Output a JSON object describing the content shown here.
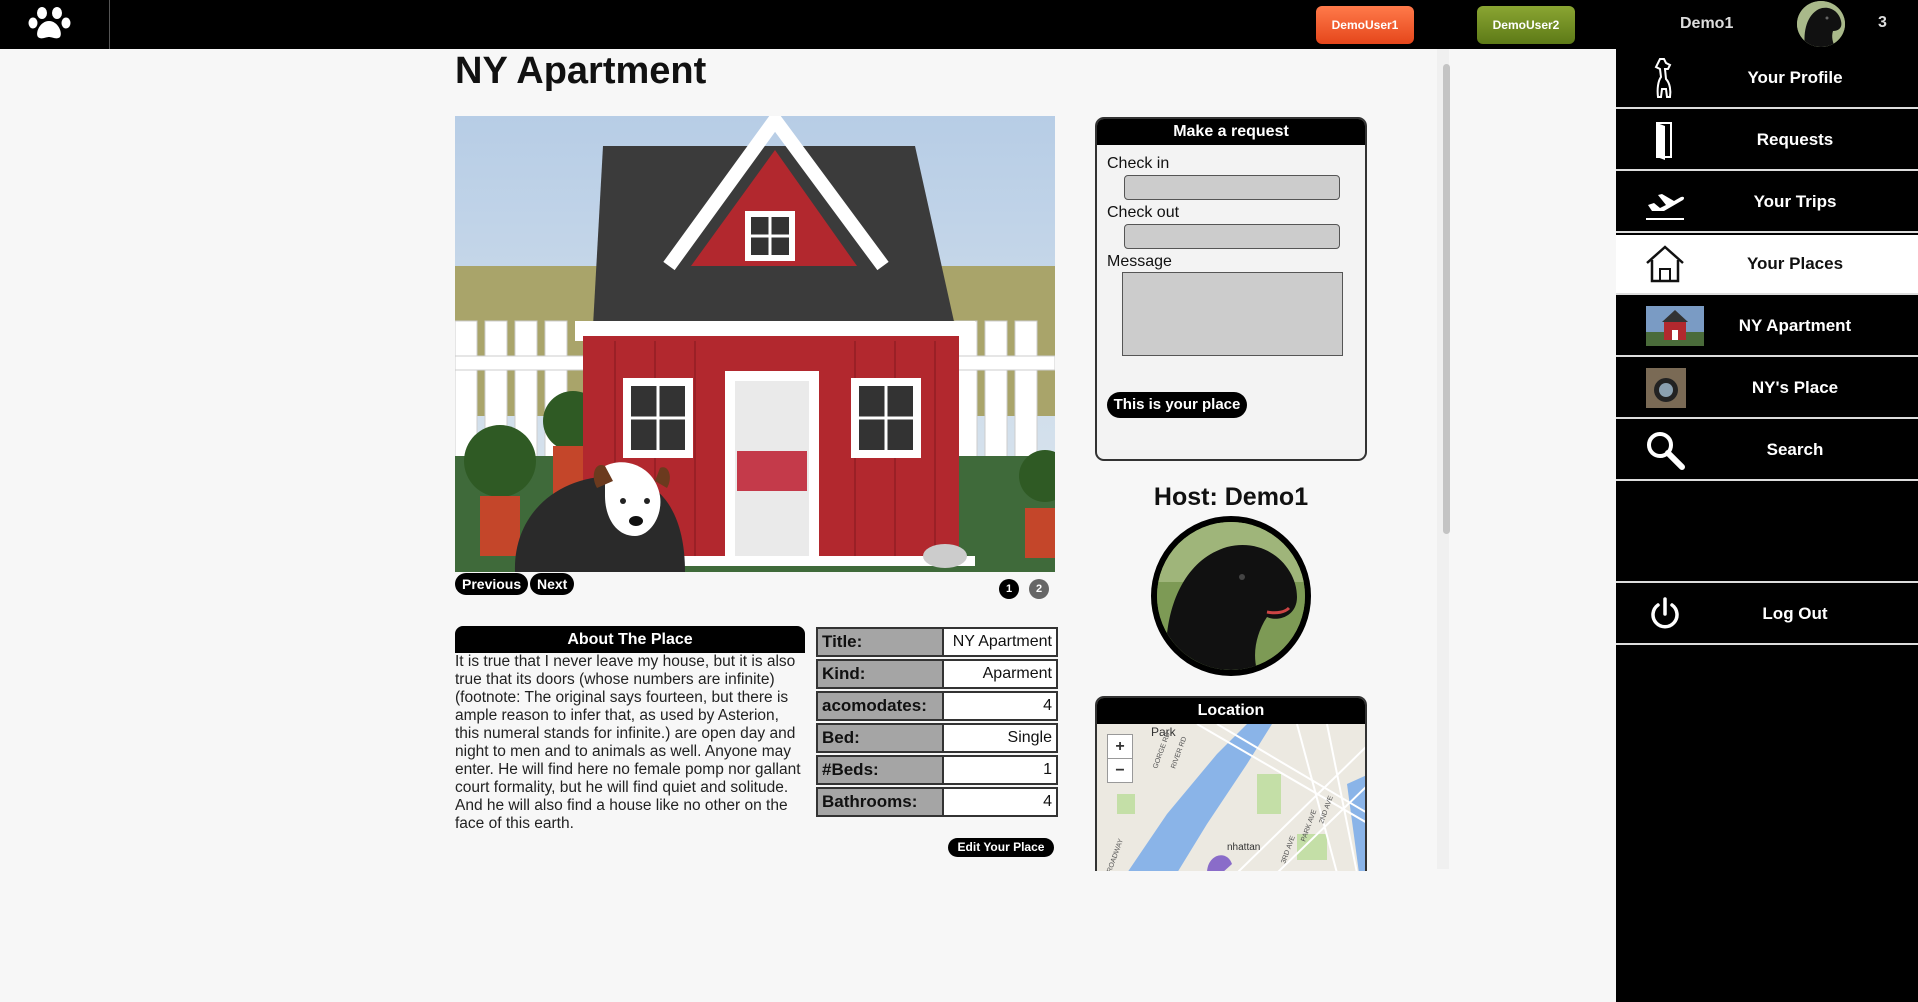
{
  "topbar": {
    "user_buttons": [
      "DemoUser1",
      "DemoUser2"
    ]
  },
  "sidebar": {
    "user_name": "Demo1",
    "notification_count": "3",
    "items": [
      {
        "label": "Your Profile",
        "icon": "dog-icon"
      },
      {
        "label": "Requests",
        "icon": "door-icon"
      },
      {
        "label": "Your Trips",
        "icon": "airplane-icon"
      },
      {
        "label": "Your Places",
        "icon": "house-icon",
        "active": true
      },
      {
        "label": "NY Apartment",
        "icon": "place-thumbnail"
      },
      {
        "label": "NY's Place",
        "icon": "place-thumbnail"
      },
      {
        "label": "Search",
        "icon": "search-icon"
      },
      {
        "label": "Log Out",
        "icon": "power-icon"
      }
    ]
  },
  "page": {
    "title": "NY Apartment"
  },
  "gallery": {
    "previous_label": "Previous",
    "next_label": "Next",
    "pages": [
      "1",
      "2"
    ],
    "current_page": 1
  },
  "about": {
    "heading": "About The Place",
    "text": "It is true that I never leave my house, but it is also true that its doors (whose numbers are infinite) (footnote: The original says fourteen, but there is ample reason to infer that, as used by Asterion, this numeral stands for infinite.) are open day and night to men and to animals as well. Anyone may enter. He will find here no female pomp nor gallant court formality, but he will find quiet and solitude. And he will also find a house like no other on the face of this earth."
  },
  "details": {
    "rows": [
      {
        "label": "Title:",
        "value": "NY Apartment"
      },
      {
        "label": "Kind:",
        "value": "Aparment"
      },
      {
        "label": "acomodates:",
        "value": "4"
      },
      {
        "label": "Bed:",
        "value": "Single"
      },
      {
        "label": "#Beds:",
        "value": "1"
      },
      {
        "label": "Bathrooms:",
        "value": "4"
      }
    ],
    "edit_label": "Edit Your Place"
  },
  "request": {
    "heading": "Make a request",
    "check_in_label": "Check in",
    "check_out_label": "Check out",
    "message_label": "Message",
    "button_label": "This is your place"
  },
  "host": {
    "label": "Host: Demo1"
  },
  "location": {
    "heading": "Location",
    "zoom_in": "+",
    "zoom_out": "−",
    "map_labels": [
      "Park",
      "GORGE RD",
      "RIVER RD",
      "ROADWAY",
      "nhattan",
      "3RD AVE",
      "PARK AVE",
      "2ND AVE"
    ]
  },
  "colors": {
    "demo_user1": "#f05a2a",
    "demo_user2": "#6f8c20",
    "sidebar_bg": "#000000",
    "active_item_bg": "#ffffff"
  }
}
